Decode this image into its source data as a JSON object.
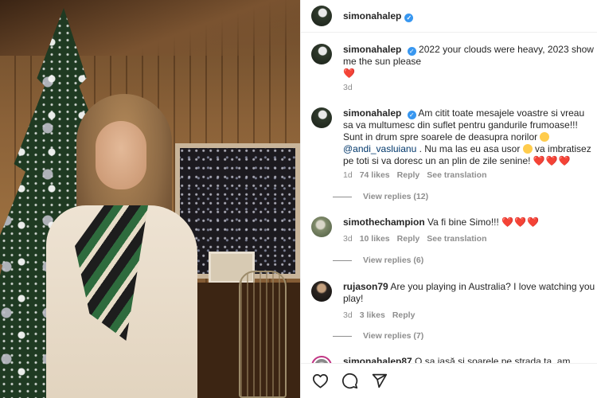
{
  "header": {
    "username": "simonahalep",
    "verified_glyph": "✓"
  },
  "caption": {
    "username": "simonahalep",
    "text": "2022 your clouds were heavy, 2023 show me the sun please",
    "emoji": "❤️",
    "time": "3d"
  },
  "comments": [
    {
      "username": "simonahalep",
      "text_part1": "Am citit toate mesajele voastre si vreau sa va multumesc din suflet pentru gandurile frumoase!!! Sunt in drum spre soarele de deasupra norilor",
      "mention": "@andi_vasluianu",
      "text_part2": ". Nu ma las eu asa usor",
      "text_part3": "va imbratisez pe toti si va doresc un an plin de zile senine!",
      "hearts": "❤️❤️❤️",
      "time": "1d",
      "likes": "74 likes",
      "reply": "Reply",
      "translate": "See translation",
      "view_replies": "View replies (12)"
    },
    {
      "username": "simothechampion",
      "text": "Va fi bine Simo!!!",
      "hearts": "❤️❤️❤️",
      "time": "3d",
      "likes": "10 likes",
      "reply": "Reply",
      "translate": "See translation",
      "view_replies": "View replies (6)"
    },
    {
      "username": "rujason79",
      "text": "Are you playing in Australia? I love watching you play!",
      "time": "3d",
      "likes": "3 likes",
      "reply": "Reply",
      "view_replies": "View replies (7)"
    },
    {
      "username": "simonahalep87",
      "text": "O sa iasă și soarele pe strada ta, am"
    }
  ],
  "icons": {
    "like": "heart-outline-icon",
    "comment": "comment-bubble-icon",
    "share": "paper-plane-icon"
  }
}
